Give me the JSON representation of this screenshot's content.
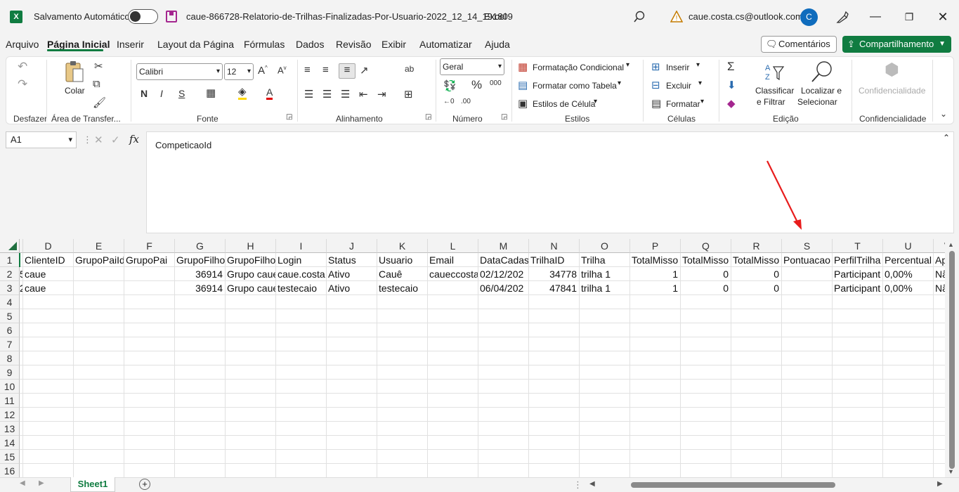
{
  "titlebar": {
    "app_icon": "X",
    "autosave_label": "Salvamento Automático",
    "filename": "caue-866728-Relatorio-de-Trilhas-Finalizadas-Por-Usuario-2022_12_14_191809",
    "app_name": "Excel",
    "account_email": "caue.costa.cs@outlook.com",
    "avatar_initial": "C"
  },
  "menu": {
    "tabs": [
      "Arquivo",
      "Página Inicial",
      "Inserir",
      "Layout da Página",
      "Fórmulas",
      "Dados",
      "Revisão",
      "Exibir",
      "Automatizar",
      "Ajuda"
    ],
    "active": "Página Inicial",
    "comments_label": "Comentários",
    "share_label": "Compartilhamento"
  },
  "ribbon": {
    "groups": {
      "undo": "Desfazer",
      "clipboard": "Área de Transfer...",
      "font": "Fonte",
      "alignment": "Alinhamento",
      "number": "Número",
      "styles": "Estilos",
      "cells": "Células",
      "editing": "Edição",
      "sensitivity": "Confidencialidade"
    },
    "paste_label": "Colar",
    "font_name": "Calibri",
    "font_size": "12",
    "bold": "N",
    "italic": "I",
    "underline": "S",
    "number_format": "Geral",
    "conditional_format": "Formatação Condicional",
    "format_as_table": "Formatar como Tabela",
    "cell_styles": "Estilos de Célula",
    "insert": "Inserir",
    "delete": "Excluir",
    "format": "Formatar",
    "sort_filter_1": "Classificar",
    "sort_filter_2": "e Filtrar",
    "find_select_1": "Localizar e",
    "find_select_2": "Selecionar",
    "sensitivity_label": "Confidencialidade",
    "percent": "%",
    "thousands": "000"
  },
  "formula_bar": {
    "name_box": "A1",
    "fx": "fx",
    "content": "CompeticaoId"
  },
  "sheet": {
    "columns": [
      "D",
      "E",
      "F",
      "G",
      "H",
      "I",
      "J",
      "K",
      "L",
      "M",
      "N",
      "O",
      "P",
      "Q",
      "R",
      "S",
      "T",
      "U",
      "V"
    ],
    "row_numbers": [
      "1",
      "2",
      "3",
      "4",
      "5",
      "6",
      "7",
      "8",
      "9",
      "10",
      "11",
      "12",
      "13",
      "14",
      "15",
      "16"
    ],
    "partial_left": [
      "",
      "5",
      "2"
    ],
    "rows": [
      [
        "ClienteID",
        "GrupoPaiId",
        "GrupoPai",
        "GrupoFilho",
        "GrupoFilho",
        "Login",
        "Status",
        "Usuario",
        "Email",
        "DataCadas",
        "TrilhaID",
        "Trilha",
        "TotalMisso",
        "TotalMisso",
        "TotalMisso",
        "Pontuacao",
        "PerfilTrilha",
        "Percentual",
        "Ap"
      ],
      [
        "caue",
        "",
        "",
        "36914",
        "Grupo caue",
        "caue.costa",
        "Ativo",
        "Cauê",
        "caueccosta",
        "02/12/202",
        "34778",
        "trilha 1",
        "1",
        "0",
        "0",
        "",
        "Participant",
        "0,00%",
        "Nã"
      ],
      [
        "caue",
        "",
        "",
        "36914",
        "Grupo caue",
        "testecaio",
        "Ativo",
        "testecaio",
        "",
        "06/04/202",
        "47841",
        "trilha 1",
        "1",
        "0",
        "0",
        "",
        "Participant",
        "0,00%",
        "Nã"
      ]
    ],
    "numeric_columns": [
      3,
      10,
      12,
      13,
      14
    ],
    "sheet_tab": "Sheet1"
  }
}
